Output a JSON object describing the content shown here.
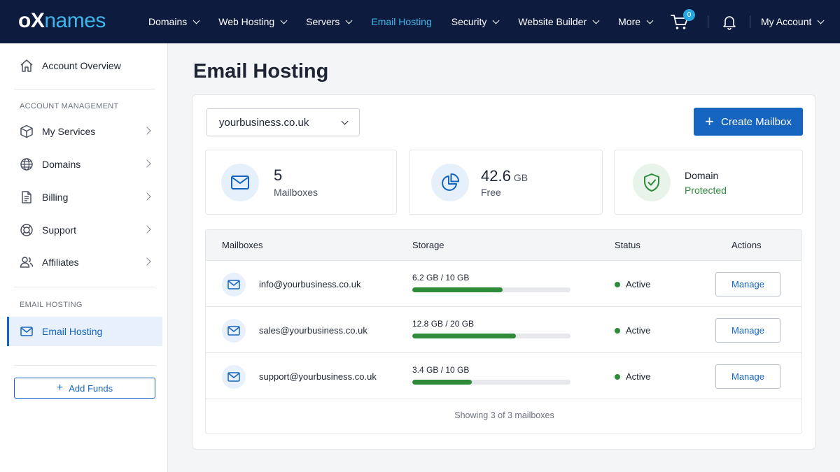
{
  "brand": {
    "logo_a": "o",
    "logo_x": "X",
    "logo_b": "names"
  },
  "nav": {
    "items": [
      {
        "label": "Domains",
        "dropdown": true
      },
      {
        "label": "Web Hosting",
        "dropdown": true
      },
      {
        "label": "Servers",
        "dropdown": true
      },
      {
        "label": "Email Hosting",
        "dropdown": false,
        "active": true
      },
      {
        "label": "Security",
        "dropdown": true
      },
      {
        "label": "Website Builder",
        "dropdown": true
      },
      {
        "label": "More",
        "dropdown": true
      }
    ],
    "cart_count": "0",
    "account_label": "My Account"
  },
  "sidebar": {
    "overview": "Account Overview",
    "section_account": "ACCOUNT MANAGEMENT",
    "items": [
      {
        "label": "My Services",
        "icon": "box-icon"
      },
      {
        "label": "Domains",
        "icon": "globe-icon"
      },
      {
        "label": "Billing",
        "icon": "document-icon"
      },
      {
        "label": "Support",
        "icon": "lifebuoy-icon"
      },
      {
        "label": "Affiliates",
        "icon": "users-icon"
      }
    ],
    "section_email": "EMAIL HOSTING",
    "email_item": "Email Hosting",
    "add_funds": "Add Funds"
  },
  "main": {
    "title": "Email Hosting",
    "domain_selected": "yourbusiness.co.uk",
    "create_label": "Create Mailbox",
    "stats": {
      "mailboxes_value": "5",
      "mailboxes_label": "Mailboxes",
      "storage_value": "42.6",
      "storage_unit": "GB",
      "storage_label": "Free",
      "domain_label": "Domain",
      "domain_status": "Protected"
    },
    "table": {
      "headers": {
        "mailboxes": "Mailboxes",
        "storage": "Storage",
        "status": "Status",
        "actions": "Actions"
      },
      "rows": [
        {
          "email": "info@yourbusiness.co.uk",
          "usage": "6.2 GB / 10 GB",
          "used_fraction": 0.57,
          "status": "Active",
          "action": "Manage"
        },
        {
          "email": "sales@yourbusiness.co.uk",
          "usage": "12.8 GB / 20 GB",
          "used_fraction": 0.655,
          "status": "Active",
          "action": "Manage"
        },
        {
          "email": "support@yourbusiness.co.uk",
          "usage": "3.4 GB / 10 GB",
          "used_fraction": 0.375,
          "status": "Active",
          "action": "Manage"
        }
      ],
      "footer": "Showing 3 of 3 mailboxes"
    }
  },
  "colors": {
    "nav_bg": "#0d1b3e",
    "accent": "#1565c0",
    "brand_cyan": "#3fb6ea",
    "active_green": "#2e8b3a"
  }
}
